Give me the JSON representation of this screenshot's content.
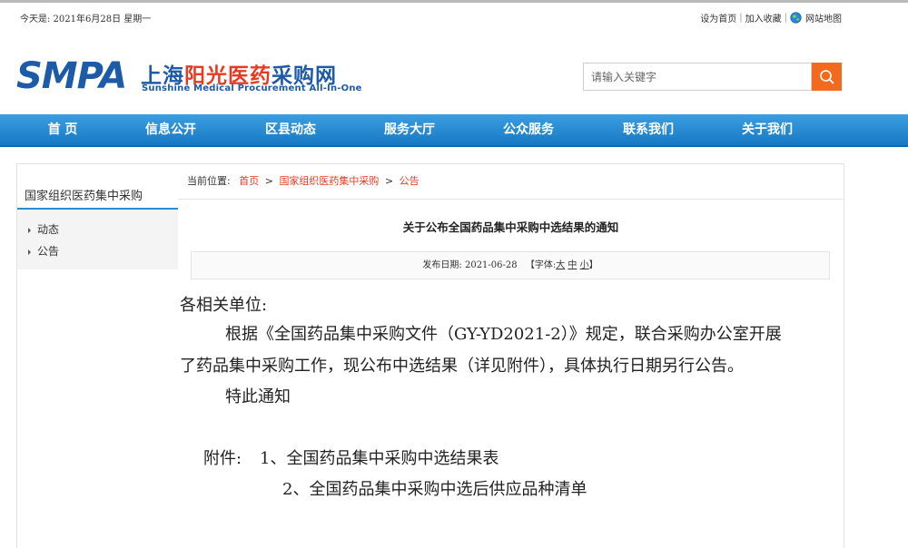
{
  "topbar": {
    "date": "今天是: 2021年6月28日 星期一",
    "set_home": "设为首页",
    "add_favorite": "加入收藏",
    "site_map": "网站地图"
  },
  "logo": {
    "abbr": "SMPA",
    "cn_part1": "上海",
    "cn_part2": "阳光医药",
    "cn_part3": "采购网",
    "en": "Sunshine Medical Procurement All-In-One"
  },
  "search": {
    "placeholder": "请输入关键字"
  },
  "nav": {
    "items": [
      "首 页",
      "信息公开",
      "区县动态",
      "服务大厅",
      "公众服务",
      "联系我们",
      "关于我们"
    ]
  },
  "sidebar": {
    "title": "国家组织医药集中采购",
    "items": [
      "动态",
      "公告"
    ]
  },
  "breadcrumb": {
    "label": "当前位置:",
    "home": "首页",
    "level1": "国家组织医药集中采购",
    "level2": "公告",
    "separator": ">"
  },
  "article": {
    "title": "关于公布全国药品集中采购中选结果的通知",
    "publish_label": "发布日期: 2021-06-28",
    "font_label_open": "【字体:",
    "font_large": "大",
    "font_medium": "中",
    "font_small": "小",
    "font_label_close": "】",
    "salutation": "各相关单位:",
    "para1_line1": "根据《全国药品集中采购文件（GY-YD2021-2）》规定，联合采购办公室开展",
    "para1_line2": "了药品集中采购工作，现公布中选结果（详见附件），具体执行日期另行公告。",
    "closing": "特此通知",
    "attach_label": "附件:",
    "attach1": "1、全国药品集中采购中选结果表",
    "attach2": "2、全国药品集中采购中选后供应品种清单"
  },
  "colors": {
    "brand_blue": "#1d5aa7",
    "accent_red": "#e63b22",
    "nav_blue": "#1679c4",
    "search_orange": "#f26a1d"
  }
}
